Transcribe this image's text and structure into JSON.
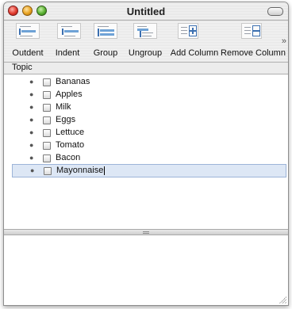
{
  "window": {
    "title": "Untitled"
  },
  "toolbar": {
    "items": [
      {
        "label": "Outdent",
        "icon": "outdent-icon"
      },
      {
        "label": "Indent",
        "icon": "indent-icon"
      },
      {
        "label": "Group",
        "icon": "group-icon"
      },
      {
        "label": "Ungroup",
        "icon": "ungroup-icon"
      },
      {
        "label": "Add Column",
        "icon": "add-column-icon"
      },
      {
        "label": "Remove Column",
        "icon": "remove-column-icon"
      }
    ],
    "overflow_glyph": "»"
  },
  "outline": {
    "column_header": "Topic",
    "rows": [
      {
        "text": "Bananas",
        "checked": false
      },
      {
        "text": "Apples",
        "checked": false
      },
      {
        "text": "Milk",
        "checked": false
      },
      {
        "text": "Eggs",
        "checked": false
      },
      {
        "text": "Lettuce",
        "checked": false
      },
      {
        "text": "Tomato",
        "checked": false
      },
      {
        "text": "Bacon",
        "checked": false
      },
      {
        "text": "Mayonnaise",
        "checked": false,
        "selected": true,
        "editing": true
      }
    ]
  },
  "colors": {
    "selection": "#dde7f5",
    "accent": "#3b6fb0"
  }
}
